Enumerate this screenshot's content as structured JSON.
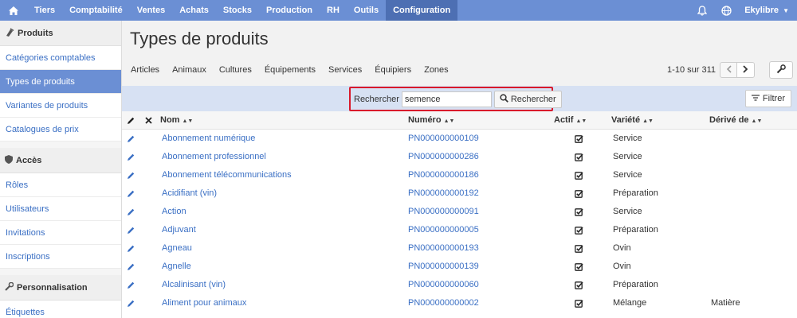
{
  "topnav": {
    "items": [
      "Tiers",
      "Comptabilité",
      "Ventes",
      "Achats",
      "Stocks",
      "Production",
      "RH",
      "Outils",
      "Configuration"
    ],
    "active_index": 8,
    "user": "Ekylibre"
  },
  "sidebar": {
    "sections": [
      {
        "title": "Produits",
        "items": [
          "Catégories comptables",
          "Types de produits",
          "Variantes de produits",
          "Catalogues de prix"
        ]
      },
      {
        "title": "Accès",
        "items": [
          "Rôles",
          "Utilisateurs",
          "Invitations",
          "Inscriptions"
        ]
      },
      {
        "title": "Personnalisation",
        "items": [
          "Étiquettes"
        ]
      }
    ],
    "active_item": "Types de produits"
  },
  "main": {
    "title": "Types de produits",
    "tabs": [
      "Articles",
      "Animaux",
      "Cultures",
      "Équipements",
      "Services",
      "Équipiers",
      "Zones"
    ],
    "pager": "1-10 sur 311",
    "search": {
      "label": "Rechercher",
      "value": "semence",
      "button": "Rechercher"
    },
    "filter_label": "Filtrer",
    "columns": [
      "Nom",
      "Numéro",
      "Actif",
      "Variété",
      "Dérivé de"
    ],
    "rows": [
      {
        "name": "Abonnement numérique",
        "number": "PN000000000109",
        "variety": "Service",
        "derived": ""
      },
      {
        "name": "Abonnement professionnel",
        "number": "PN000000000286",
        "variety": "Service",
        "derived": ""
      },
      {
        "name": "Abonnement télécommunications",
        "number": "PN000000000186",
        "variety": "Service",
        "derived": ""
      },
      {
        "name": "Acidifiant (vin)",
        "number": "PN000000000192",
        "variety": "Préparation",
        "derived": ""
      },
      {
        "name": "Action",
        "number": "PN000000000091",
        "variety": "Service",
        "derived": ""
      },
      {
        "name": "Adjuvant",
        "number": "PN000000000005",
        "variety": "Préparation",
        "derived": ""
      },
      {
        "name": "Agneau",
        "number": "PN000000000193",
        "variety": "Ovin",
        "derived": ""
      },
      {
        "name": "Agnelle",
        "number": "PN000000000139",
        "variety": "Ovin",
        "derived": ""
      },
      {
        "name": "Alcalinisant (vin)",
        "number": "PN000000000060",
        "variety": "Préparation",
        "derived": ""
      },
      {
        "name": "Aliment pour animaux",
        "number": "PN000000000002",
        "variety": "Mélange",
        "derived": "Matière"
      }
    ]
  },
  "colors": {
    "nav": "#6b8fd4",
    "nav_active": "#4d6fb3",
    "link": "#3a6fc4",
    "search_bg": "#d7e1f3",
    "highlight": "#d9192b"
  }
}
